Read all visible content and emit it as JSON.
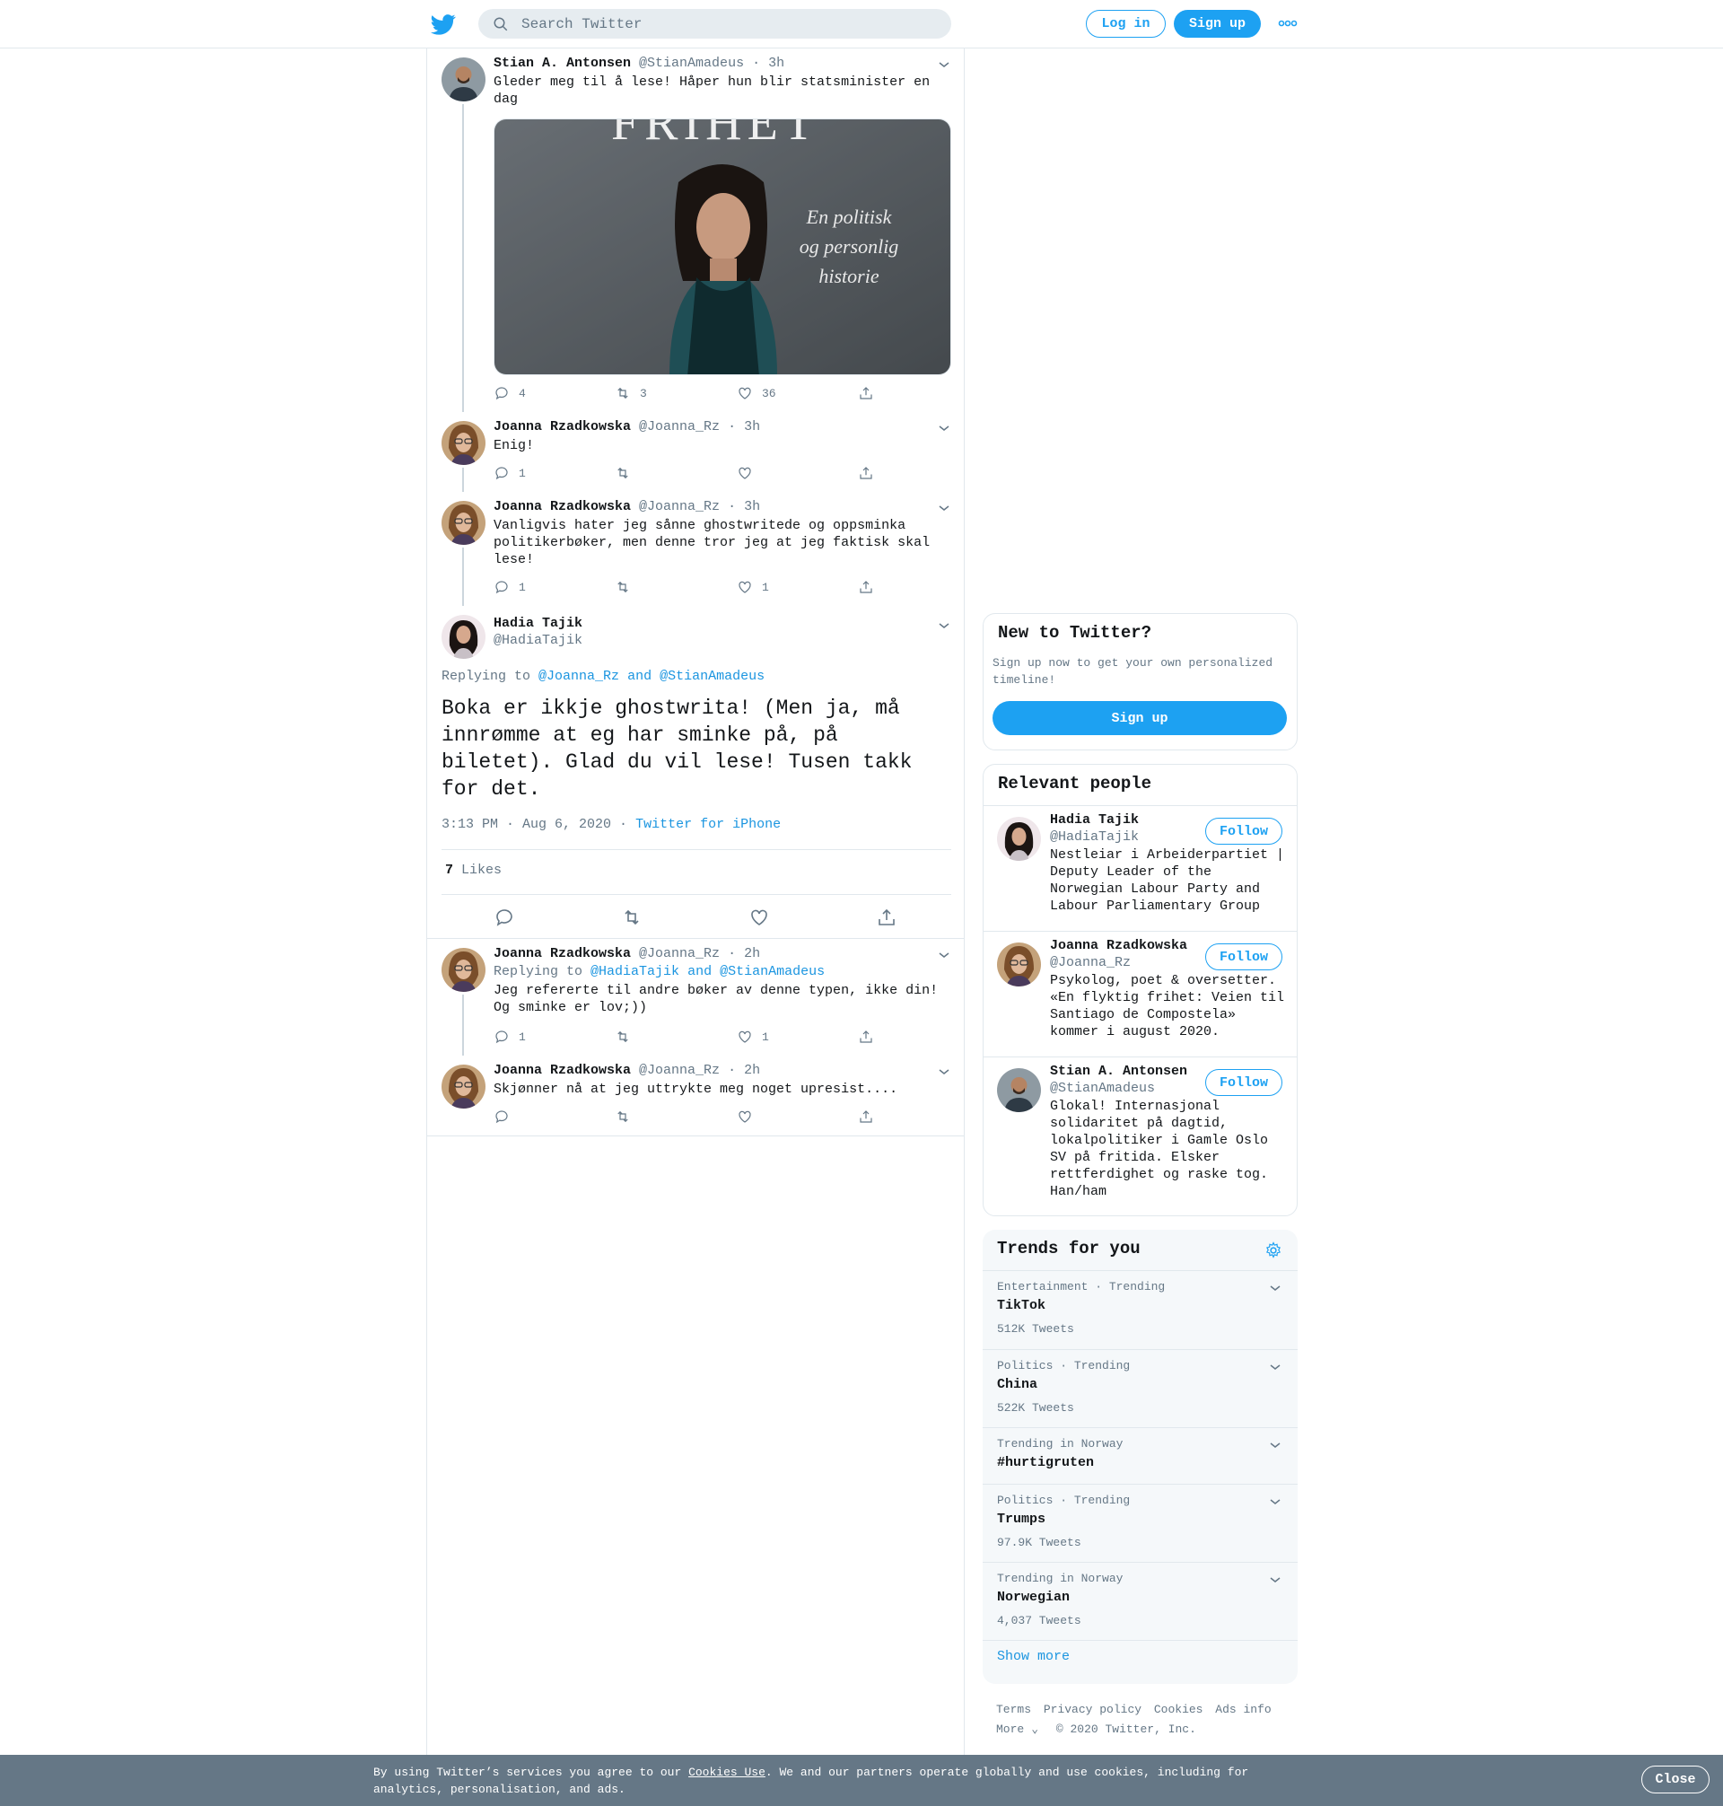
{
  "header": {
    "search_placeholder": "Search Twitter",
    "login_label": "Log in",
    "signup_label": "Sign up"
  },
  "thread": [
    {
      "name": "Stian A. Antonsen",
      "handle": "@StianAmadeus",
      "time": "· 3h",
      "text": "Gleder meg til å lese! Håper hun blir statsminister en dag",
      "image_title": "FRIHET",
      "image_caption_lines": [
        "En politisk",
        "og personlig",
        "historie"
      ],
      "replies": "4",
      "retweets": "3",
      "likes": "36"
    },
    {
      "name": "Joanna Rzadkowska",
      "handle": "@Joanna_Rz",
      "time": "· 3h",
      "text": "Enig!",
      "replies": "1",
      "retweets": "",
      "likes": ""
    },
    {
      "name": "Joanna Rzadkowska",
      "handle": "@Joanna_Rz",
      "time": "· 3h",
      "text": "Vanligvis hater jeg sånne ghostwritede og oppsminka politikerbøker, men denne tror jeg at jeg faktisk skal lese!",
      "replies": "1",
      "retweets": "",
      "likes": "1"
    }
  ],
  "focus": {
    "name": "Hadia Tajik",
    "handle": "@HadiaTajik",
    "replying_prefix": "Replying to",
    "replying_users": "@Joanna_Rz and @StianAmadeus",
    "text": "Boka er ikkje ghostwrita! (Men ja, må innrømme at eg har sminke på, på biletet). Glad du vil lese! Tusen takk for det.",
    "timestamp": "3:13 PM · Aug 6, 2020",
    "source": "Twitter for iPhone",
    "likes_count": "7",
    "likes_label": "Likes"
  },
  "replies": [
    {
      "name": "Joanna Rzadkowska",
      "handle": "@Joanna_Rz",
      "time": "· 2h",
      "replying_prefix": "Replying to",
      "replying_users": "@HadiaTajik and @StianAmadeus",
      "text": "Jeg refererte til andre bøker av denne typen, ikke din! Og sminke er lov;))",
      "replies": "1",
      "retweets": "",
      "likes": "1"
    },
    {
      "name": "Joanna Rzadkowska",
      "handle": "@Joanna_Rz",
      "time": "· 2h",
      "text": "Skjønner nå at jeg uttrykte meg noget upresist....",
      "replies": "",
      "retweets": "",
      "likes": ""
    }
  ],
  "signup_card": {
    "title": "New to Twitter?",
    "subtitle": "Sign up now to get your own personalized timeline!",
    "button": "Sign up"
  },
  "relevant": {
    "title": "Relevant people",
    "follow_label": "Follow",
    "people": [
      {
        "name": "Hadia Tajik",
        "handle": "@HadiaTajik",
        "bio": "Nestleiar i Arbeiderpartiet | Deputy Leader of the Norwegian Labour Party and Labour Parliamentary Group"
      },
      {
        "name": "Joanna Rzadkowska",
        "handle": "@Joanna_Rz",
        "bio": "Psykolog, poet & oversetter. «En flyktig frihet: Veien til Santiago de Compostela» kommer i august 2020."
      },
      {
        "name": "Stian A. Antonsen",
        "handle": "@StianAmadeus",
        "bio": "Glokal! Internasjonal solidaritet på dagtid, lokalpolitiker i Gamle Oslo SV på fritida. Elsker rettferdighet og raske tog. Han/ham"
      }
    ]
  },
  "trends": {
    "title": "Trends for you",
    "items": [
      {
        "category": "Entertainment · Trending",
        "name": "TikTok",
        "count": "512K Tweets"
      },
      {
        "category": "Politics · Trending",
        "name": "China",
        "count": "522K Tweets"
      },
      {
        "category": "Trending in Norway",
        "name": "#hurtigruten",
        "count": ""
      },
      {
        "category": "Politics · Trending",
        "name": "Trumps",
        "count": "97.9K Tweets"
      },
      {
        "category": "Trending in Norway",
        "name": "Norwegian",
        "count": "4,037 Tweets"
      }
    ],
    "show_more": "Show more"
  },
  "footer": {
    "links": [
      "Terms",
      "Privacy policy",
      "Cookies",
      "Ads info"
    ],
    "more": "More",
    "copyright": "© 2020 Twitter, Inc."
  },
  "cookie_bar": {
    "text_before": "By using Twitter’s services you agree to our ",
    "link": "Cookies Use",
    "text_after": ". We and our partners operate globally and use cookies, including for analytics, personalisation, and ads.",
    "close": "Close"
  },
  "colors": {
    "accent": "#1da1f2",
    "link": "#1b95e0",
    "secondary_text": "#657786",
    "border": "#e1e8ed",
    "cookie_bar": "#657786"
  }
}
